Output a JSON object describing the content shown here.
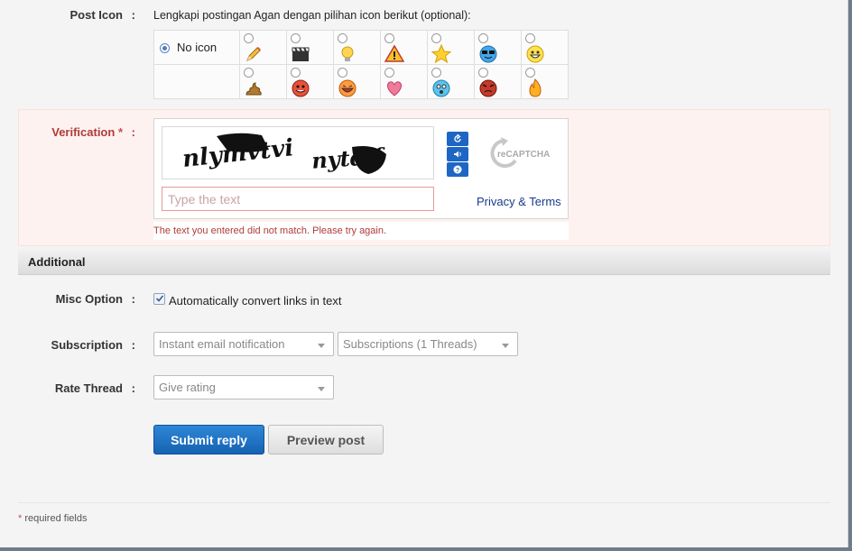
{
  "post_icon": {
    "label": "Post Icon",
    "colon": ":",
    "description": "Lengkapi postingan Agan dengan pilihan icon berikut (optional):",
    "no_icon_label": "No icon",
    "row1_icons": [
      "pencil-icon",
      "clapperboard-icon",
      "lightbulb-icon",
      "warning-icon",
      "star-icon",
      "cool-smiley-icon",
      "grin-smiley-icon"
    ],
    "row2_icons": [
      "poop-icon",
      "evil-smiley-icon",
      "laughing-smiley-icon",
      "heart-icon",
      "surprised-smiley-icon",
      "angry-smiley-icon",
      "fire-smiley-icon"
    ]
  },
  "verification": {
    "label": "Verification",
    "required_mark": "*",
    "colon": ":",
    "captcha_words": [
      "nlymvtvi",
      "nytdlf"
    ],
    "input_placeholder": "Type the text",
    "recaptcha_brand": "reCAPTCHA",
    "privacy_link": "Privacy & Terms",
    "error": "The text you entered did not match. Please try again."
  },
  "additional": {
    "heading": "Additional",
    "misc_label": "Misc Option",
    "misc_checkbox_label": "Automatically convert links in text",
    "misc_checked": true,
    "subscription_label": "Subscription",
    "subscription_select": "Instant email notification",
    "subscription_threads_select": "Subscriptions (1 Threads)",
    "rate_label": "Rate Thread",
    "rate_select": "Give rating",
    "colon": ":"
  },
  "actions": {
    "submit": "Submit reply",
    "preview": "Preview post"
  },
  "footer": {
    "required_mark": "*",
    "required_note": "required fields"
  },
  "colors": {
    "primary_button": "#1e6fc4",
    "error_text": "#b03a3a",
    "verification_bg": "#fdf2f0"
  }
}
